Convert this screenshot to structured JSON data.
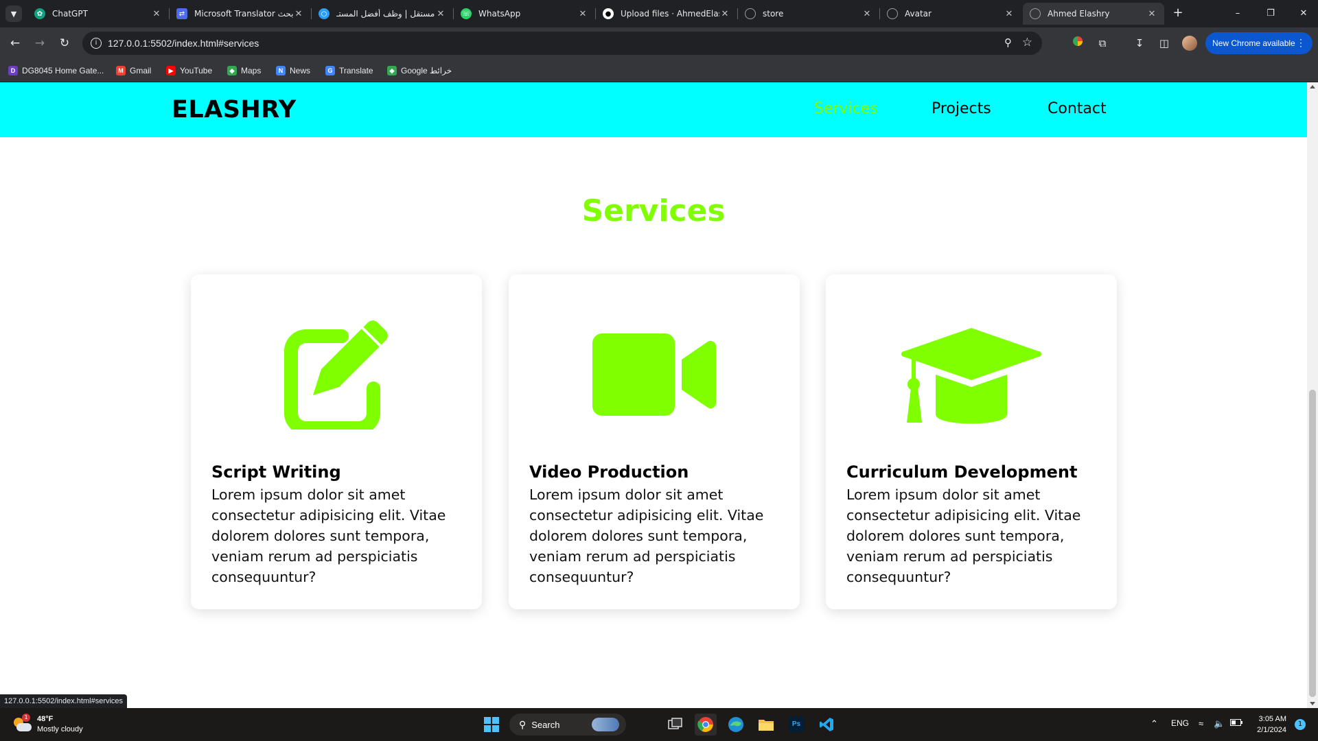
{
  "browser": {
    "tabs": [
      {
        "title": "ChatGPT",
        "icon": "chatgpt-icon",
        "color": "#10a37f",
        "active": false
      },
      {
        "title": "Microsoft Translator بحث",
        "icon": "translator-icon",
        "color": "#4f6bed",
        "active": false
      },
      {
        "title": "مستقل | وظف أفضل المستـ",
        "icon": "mostaql-icon",
        "color": "#2a9df4",
        "active": false
      },
      {
        "title": "WhatsApp",
        "icon": "whatsapp-icon",
        "color": "#25d366",
        "active": false
      },
      {
        "title": "Upload files · AhmedElash",
        "icon": "github-icon",
        "color": "#ffffff",
        "active": false
      },
      {
        "title": "store",
        "icon": "globe-icon",
        "color": "#9aa0a6",
        "active": false
      },
      {
        "title": "Avatar",
        "icon": "globe-icon",
        "color": "#9aa0a6",
        "active": false
      },
      {
        "title": "Ahmed Elashry",
        "icon": "globe-icon",
        "color": "#9aa0a6",
        "active": true
      }
    ],
    "url": "127.0.0.1:5502/index.html#services",
    "update_label": "New Chrome available",
    "bookmarks": [
      {
        "label": "DG8045 Home Gate...",
        "color": "#6c3ec1"
      },
      {
        "label": "Gmail",
        "color": "#ea4335"
      },
      {
        "label": "YouTube",
        "color": "#ff0000"
      },
      {
        "label": "Maps",
        "color": "#34a853"
      },
      {
        "label": "News",
        "color": "#4285f4"
      },
      {
        "label": "Translate",
        "color": "#4285f4"
      },
      {
        "label": "Google خرائط",
        "color": "#34a853"
      }
    ],
    "status_url": "127.0.0.1:5502/index.html#services"
  },
  "site": {
    "logo": "ELASHRY",
    "nav": [
      {
        "label": "Services",
        "color": "#7fff00"
      },
      {
        "label": "Projects",
        "color": "#000000"
      },
      {
        "label": "Contact",
        "color": "#000000"
      }
    ],
    "section_title": "Services",
    "accent_color": "#7fff00",
    "header_color": "#00ffff",
    "cards": [
      {
        "icon": "edit-pencil-icon",
        "title": "Script Writing",
        "text": "Lorem ipsum dolor sit amet consectetur adipisicing elit. Vitae dolorem dolores sunt tempora, veniam rerum ad perspiciatis consequuntur?"
      },
      {
        "icon": "video-camera-icon",
        "title": "Video Production",
        "text": "Lorem ipsum dolor sit amet consectetur adipisicing elit. Vitae dolorem dolores sunt tempora, veniam rerum ad perspiciatis consequuntur?"
      },
      {
        "icon": "graduation-cap-icon",
        "title": "Curriculum Development",
        "text": "Lorem ipsum dolor sit amet consectetur adipisicing elit. Vitae dolorem dolores sunt tempora, veniam rerum ad perspiciatis consequuntur?"
      }
    ]
  },
  "taskbar": {
    "weather_temp": "48°F",
    "weather_desc": "Mostly cloudy",
    "weather_badge": "1",
    "search_label": "Search",
    "language": "ENG",
    "time": "3:05 AM",
    "date": "2/1/2024",
    "notifications": "1"
  }
}
